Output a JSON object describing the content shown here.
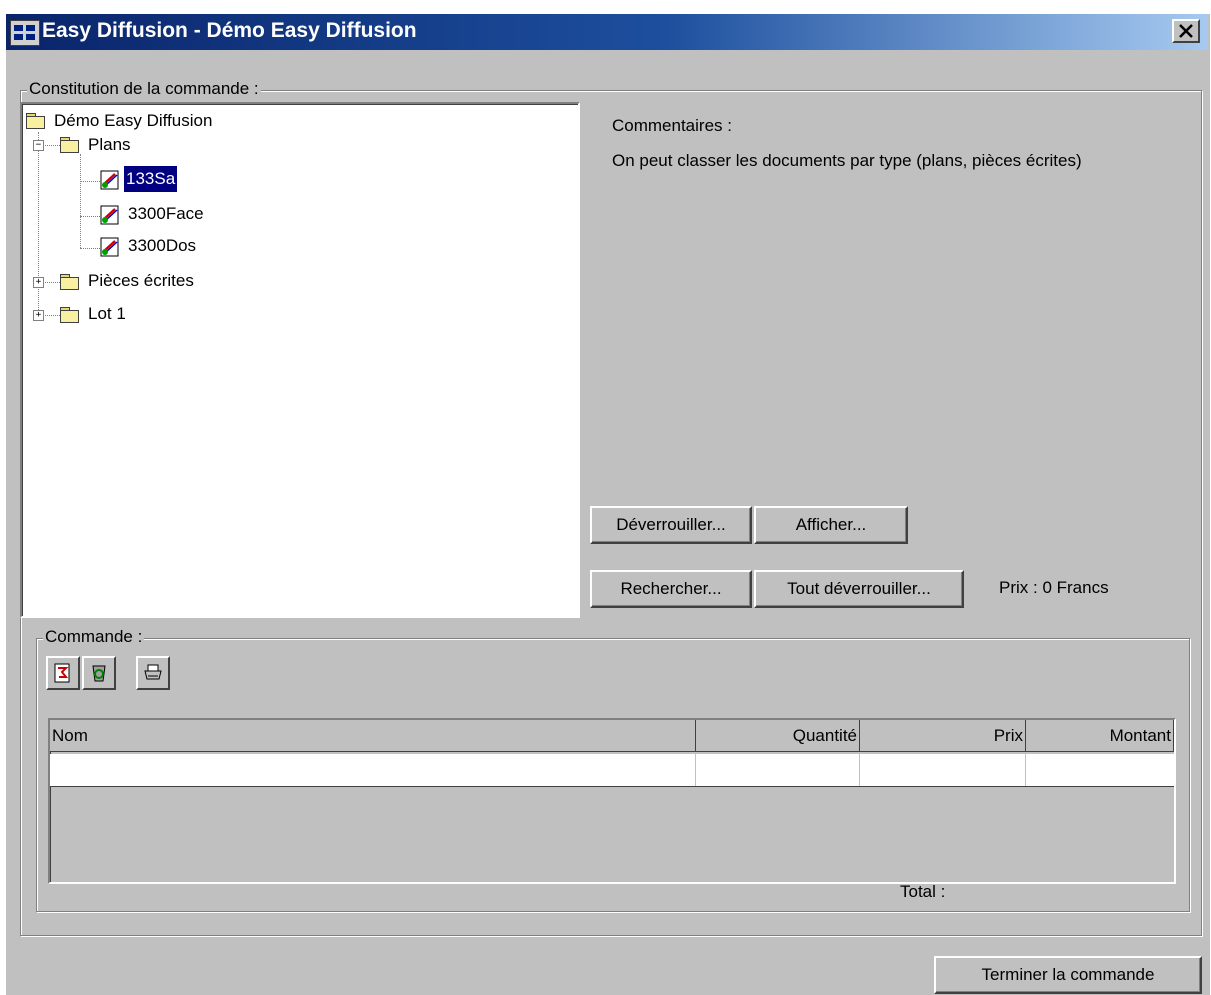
{
  "window": {
    "title": "Easy Diffusion - Démo Easy Diffusion"
  },
  "order_setup": {
    "legend": "Constitution de la commande :",
    "tree": {
      "root": "Démo Easy Diffusion",
      "plans": "Plans",
      "documents": [
        "133Sa",
        "3300Face",
        "3300Dos"
      ],
      "selected": "133Sa",
      "written_pieces": "Pièces écrites",
      "lot": "Lot 1"
    },
    "comments_label": "Commentaires :",
    "comments_text": "On peut classer les documents par type (plans, pièces écrites)",
    "buttons": {
      "unlock": "Déverrouiller...",
      "show": "Afficher...",
      "search": "Rechercher...",
      "unlock_all": "Tout déverrouiller..."
    },
    "price": "Prix : 0 Francs"
  },
  "order": {
    "legend": "Commande :",
    "toolbar_icons": [
      "import-icon",
      "recycle-icon",
      "print-icon"
    ],
    "columns": [
      "Nom",
      "Quantité",
      "Prix",
      "Montant"
    ],
    "rows": [
      [
        "",
        "",
        "",
        ""
      ]
    ],
    "total_label": "Total :"
  },
  "footer": {
    "finish_button": "Terminer la commande"
  },
  "colors": {
    "dialog": "#c0c0c0",
    "title_bar": "#0a246a",
    "selection": "#000080"
  }
}
